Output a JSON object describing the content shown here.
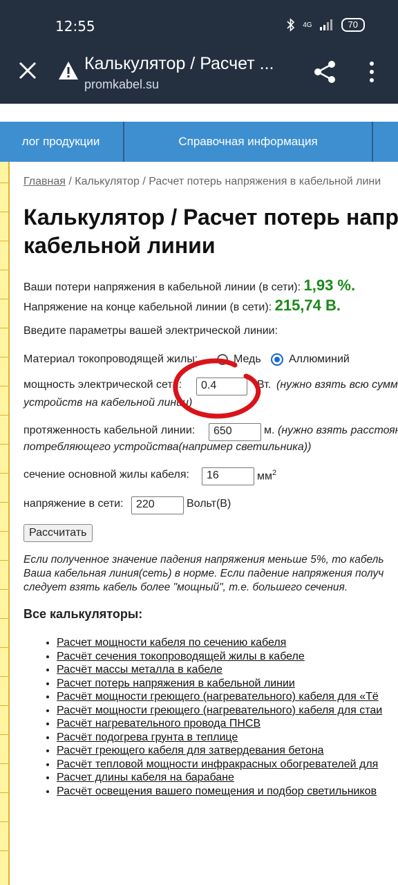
{
  "status": {
    "time": "12:55",
    "network": "4G",
    "battery": "70"
  },
  "browser": {
    "title": "Калькулятор / Расчет ...",
    "domain": "promkabel.su"
  },
  "nav": {
    "items": [
      "лог продукции",
      "Справочная информация",
      ""
    ]
  },
  "breadcrumb": {
    "home": "Главная",
    "sep1": " / ",
    "calc": "Калькулятор",
    "sep2": " / ",
    "current": "Расчет потерь напряжения в кабельной лини"
  },
  "page": {
    "title_line1": "Калькулятор / Расчет потерь напр",
    "title_line2": "кабельной линии"
  },
  "results": {
    "loss_label": "Ваши потери напряжения в кабельной линии (в сети): ",
    "loss_value": "1,93 %.",
    "end_voltage_label": "Напряжение на конце кабельной линии (в сети): ",
    "end_voltage_value": "215,74 В."
  },
  "form": {
    "intro": "Введите параметры вашей электрической линии:",
    "material_label": "Материал токопроводящей жилы:",
    "material_copper": "Медь",
    "material_aluminium": "Аллюминий",
    "material_selected": "Аллюминий",
    "power_label": "мощность электрической сети:",
    "power_value": "0.4",
    "power_unit": "Вт.",
    "power_hint1": "(нужно взять всю сумм",
    "power_hint2": "устройств на кабельной линии)",
    "length_label": "протяженность кабельной линии:",
    "length_value": "650",
    "length_unit": "м.",
    "length_hint1": "(нужно взять расстоян",
    "length_hint2": "потребляющего устройства(например светильника))",
    "section_label": "сечение основной жилы кабеля:",
    "section_value": "16",
    "section_unit": "мм",
    "section_unit_sup": "2",
    "voltage_label": "напряжение в сети:",
    "voltage_value": "220",
    "voltage_unit": "Вольт(В)",
    "submit": "Рассчитать"
  },
  "note": {
    "line1": "Если полученное значение падения напряжения меньше 5%, то кабель",
    "line2": "Ваша кабельная линия(сеть) в норме. Если падение напряжения получ",
    "line3": "следует взять кабель более \"мощный\", т.е. большего сечения."
  },
  "calculators": {
    "heading": "Все калькуляторы:",
    "items": [
      "Расчет мощности кабеля по сечению кабеля",
      "Расчёт сечения токопроводящей жилы в кабеле",
      "Расчёт массы металла в кабеле",
      "Расчет потерь напряжения в кабельной линии",
      "Расчёт мощности греющего (нагревательного) кабеля для «Тё",
      "Расчёт мощности греющего (нагревательного) кабеля для стаи",
      "Расчёт нагревательного провода ПНСВ",
      "Расчёт подогрева грунта в теплице",
      "Расчёт греющего кабеля для затвердевания бетона",
      "Расчёт тепловой мощности инфракрасных обогревателей для",
      "Расчет длины кабеля на барабане",
      "Расчёт освещения вашего помещения и подбор светильников"
    ]
  },
  "colors": {
    "header_bg": "#243040",
    "nav_bg": "#3e8fd0",
    "result_green": "#1a8a1a",
    "annotation_red": "#d8141a"
  }
}
